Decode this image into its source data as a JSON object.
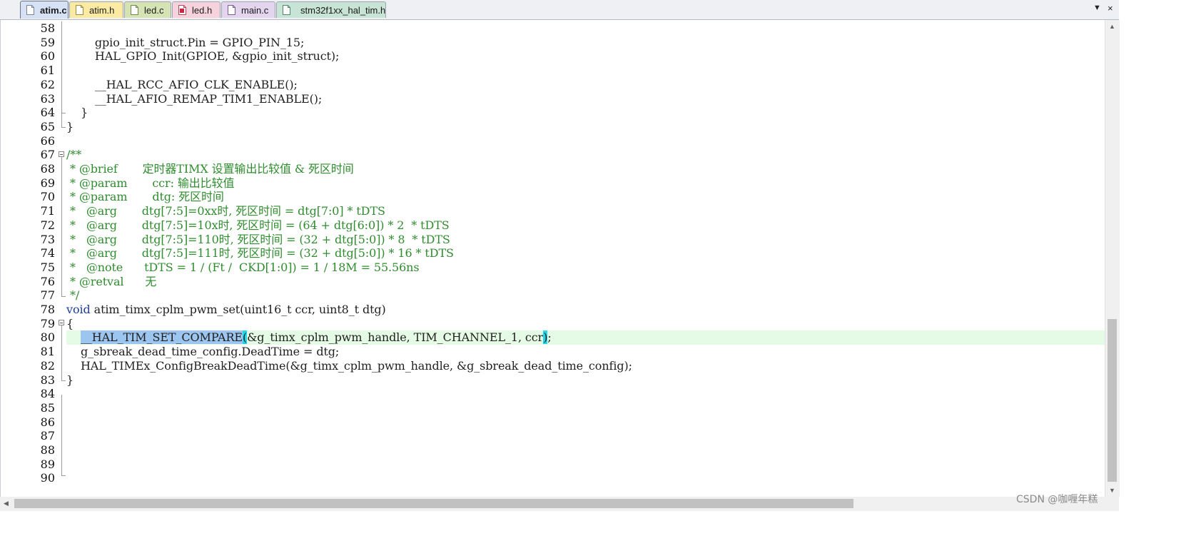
{
  "tabs": [
    {
      "label": "atim.c",
      "color": "#d6e1f5",
      "active": true
    },
    {
      "label": "atim.h",
      "color": "#fbeaa3",
      "active": false
    },
    {
      "label": "led.c",
      "color": "#d6e3b4",
      "active": false
    },
    {
      "label": "led.h",
      "color": "#f6d3dc",
      "active": false
    },
    {
      "label": "main.c",
      "color": "#e4d5ee",
      "active": false
    },
    {
      "label": "stm32f1xx_hal_tim.h",
      "color": "#c8e4d6",
      "active": false
    }
  ],
  "tab_menu_icon": "dropdown-arrow-icon",
  "tab_close_icon": "close-icon",
  "editor": {
    "line_numbers": [
      "58",
      "59",
      "60",
      "61",
      "62",
      "63",
      "64",
      "65",
      "66",
      "67",
      "68",
      "69",
      "70",
      "71",
      "72",
      "73",
      "74",
      "75",
      "76",
      "77",
      "78",
      "79",
      "80",
      "81",
      "82",
      "83",
      "84",
      "85",
      "86",
      "87",
      "88",
      "89",
      "90"
    ],
    "lines": {
      "l59": "        gpio_init_struct.Pin = GPIO_PIN_15;",
      "l60": "        HAL_GPIO_Init(GPIOE, &gpio_init_struct);",
      "l62": "        __HAL_RCC_AFIO_CLK_ENABLE();",
      "l63": "        __HAL_AFIO_REMAP_TIM1_ENABLE();",
      "l64": "    }",
      "l65": "}",
      "l67": "/**",
      "l68": " * @brief       定时器TIMX 设置输出比较值 & 死区时间",
      "l69": " * @param       ccr: 输出比较值",
      "l70": " * @param       dtg: 死区时间",
      "l71": " *   @arg       dtg[7:5]=0xx时, 死区时间 = dtg[7:0] * tDTS",
      "l72": " *   @arg       dtg[7:5]=10x时, 死区时间 = (64 + dtg[6:0]) * 2  * tDTS",
      "l73": " *   @arg       dtg[7:5]=110时, 死区时间 = (32 + dtg[5:0]) * 8  * tDTS",
      "l74": " *   @arg       dtg[7:5]=111时, 死区时间 = (32 + dtg[5:0]) * 16 * tDTS",
      "l75": " *   @note      tDTS = 1 / (Ft /  CKD[1:0]) = 1 / 18M = 55.56ns",
      "l76": " * @retval      无",
      "l77": " */",
      "l78_kw": "void",
      "l78_rest": " atim_timx_cplm_pwm_set(uint16_t ccr, uint8_t dtg)",
      "l79": "{",
      "l80_indent": "    ",
      "l80_sel": "__HAL_TIM_SET_COMPARE",
      "l80_open": "(",
      "l80_mid": "&g_timx_cplm_pwm_handle, TIM_CHANNEL_1, ccr",
      "l80_close": ")",
      "l80_end": ";",
      "l81": "    g_sbreak_dead_time_config.DeadTime = dtg;",
      "l82": "    HAL_TIMEx_ConfigBreakDeadTime(&g_timx_cplm_pwm_handle, &g_sbreak_dead_time_config);",
      "l83": "}"
    }
  },
  "colors": {
    "comment": "#2f8c2f",
    "keyword": "#1f3aa0",
    "current_line": "#e5fbe5",
    "selection": "#9cc6ef",
    "brace_match": "#21d8ea"
  },
  "watermark": "CSDN @咖喱年糕"
}
